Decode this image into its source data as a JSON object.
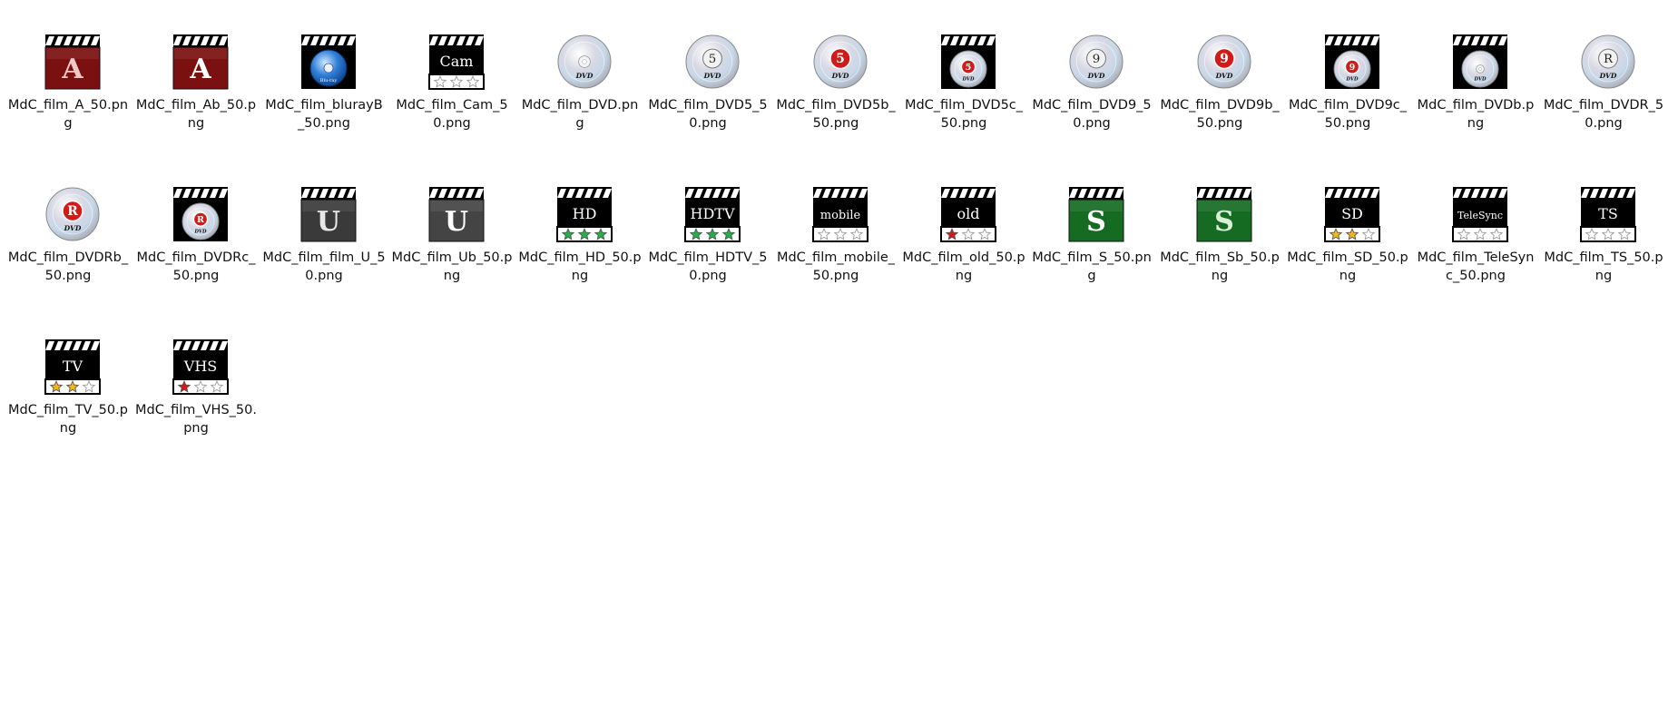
{
  "view": {
    "items": [
      {
        "name": "MdC_film_A_50.png",
        "icon": "clapper-letter-icon",
        "label": "A",
        "bg": "#7a1010",
        "fg": "#f0c8c8"
      },
      {
        "name": "MdC_film_Ab_50.png",
        "icon": "clapper-letter-icon",
        "label": "A",
        "bg": "#7a1010",
        "fg": "#ffffff"
      },
      {
        "name": "MdC_film_blurayB_50.png",
        "icon": "clapper-bluray-icon"
      },
      {
        "name": "MdC_film_Cam_50.png",
        "icon": "clapper-stars-icon",
        "label": "Cam",
        "stars": 0
      },
      {
        "name": "MdC_film_DVD.png",
        "icon": "dvd-disc-icon"
      },
      {
        "name": "MdC_film_DVD5_50.png",
        "icon": "dvd-disc-icon",
        "label": "5"
      },
      {
        "name": "MdC_film_DVD5b_50.png",
        "icon": "dvd-disc-icon",
        "label": "5",
        "badge": "#d11a1a"
      },
      {
        "name": "MdC_film_DVD5c_50.png",
        "icon": "clapper-disc-icon",
        "label": "5",
        "badge": "#d11a1a"
      },
      {
        "name": "MdC_film_DVD9_50.png",
        "icon": "dvd-disc-icon",
        "label": "9"
      },
      {
        "name": "MdC_film_DVD9b_50.png",
        "icon": "dvd-disc-icon",
        "label": "9",
        "badge": "#d11a1a"
      },
      {
        "name": "MdC_film_DVD9c_50.png",
        "icon": "clapper-disc-icon",
        "label": "9",
        "badge": "#d11a1a"
      },
      {
        "name": "MdC_film_DVDb.png",
        "icon": "clapper-disc-icon"
      },
      {
        "name": "MdC_film_DVDR_50.png",
        "icon": "dvd-disc-icon",
        "label": "R"
      },
      {
        "name": "MdC_film_DVDRb_50.png",
        "icon": "dvd-disc-icon",
        "label": "R",
        "badge": "#d11a1a"
      },
      {
        "name": "MdC_film_DVDRc_50.png",
        "icon": "clapper-disc-icon",
        "label": "R",
        "badge": "#d11a1a"
      },
      {
        "name": "MdC_film_film_U_50.png",
        "icon": "clapper-letter-icon",
        "label": "U",
        "bg": "#3a3a3a",
        "fg": "#e8e8e8"
      },
      {
        "name": "MdC_film_Ub_50.png",
        "icon": "clapper-letter-icon",
        "label": "U",
        "bg": "#444444",
        "fg": "#ffffff"
      },
      {
        "name": "MdC_film_HD_50.png",
        "icon": "clapper-stars-icon",
        "label": "HD",
        "stars": 3,
        "star_color": "#22b04a",
        "panel": "#000000"
      },
      {
        "name": "MdC_film_HDTV_50.png",
        "icon": "clapper-stars-icon",
        "label": "HDTV",
        "stars": 3,
        "star_color": "#22b04a",
        "panel": "#000000"
      },
      {
        "name": "MdC_film_mobile_50.png",
        "icon": "clapper-stars-icon",
        "label": "mobile",
        "stars": 0
      },
      {
        "name": "MdC_film_old_50.png",
        "icon": "clapper-stars-icon",
        "label": "old",
        "stars": 1,
        "star_color": "#d11a1a"
      },
      {
        "name": "MdC_film_S_50.png",
        "icon": "clapper-letter-icon",
        "label": "S",
        "bg": "#166b22",
        "fg": "#ffffff"
      },
      {
        "name": "MdC_film_Sb_50.png",
        "icon": "clapper-letter-icon",
        "label": "S",
        "bg": "#166b22",
        "fg": "#d8f0d8"
      },
      {
        "name": "MdC_film_SD_50.png",
        "icon": "clapper-stars-icon",
        "label": "SD",
        "stars": 2,
        "star_color": "#f2b818"
      },
      {
        "name": "MdC_film_TeleSync_50.png",
        "icon": "clapper-stars-icon",
        "label": "TeleSync",
        "stars": 0
      },
      {
        "name": "MdC_film_TS_50.png",
        "icon": "clapper-stars-icon",
        "label": "TS",
        "stars": 0
      },
      {
        "name": "MdC_film_TV_50.png",
        "icon": "clapper-stars-icon",
        "label": "TV",
        "stars": 2,
        "star_color": "#f2b818"
      },
      {
        "name": "MdC_film_VHS_50.png",
        "icon": "clapper-stars-icon",
        "label": "VHS",
        "stars": 1,
        "star_color": "#d11a1a"
      }
    ]
  }
}
